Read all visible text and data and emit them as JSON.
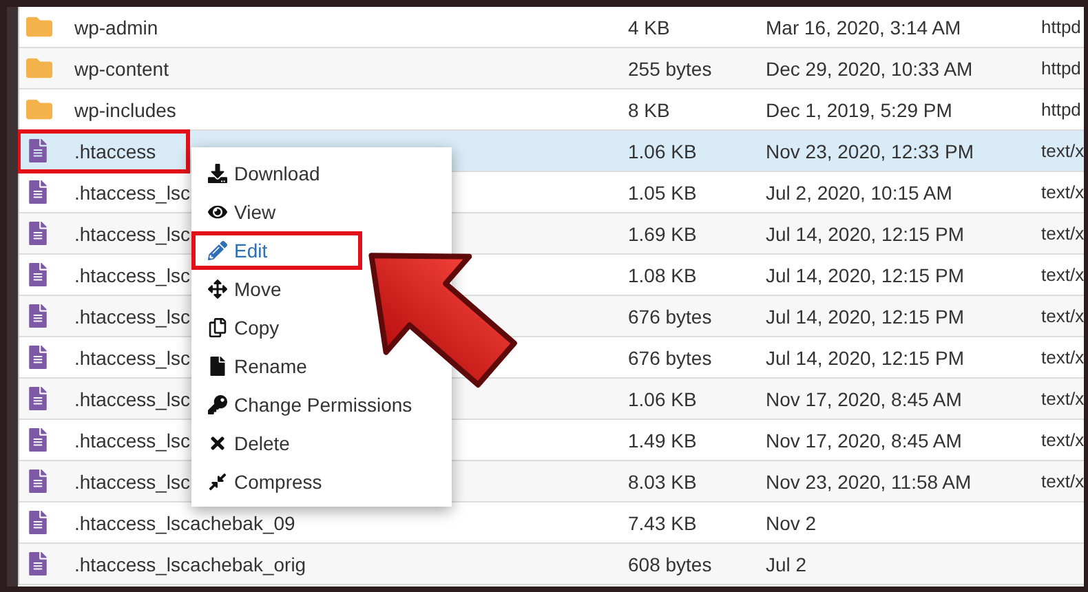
{
  "files": [
    {
      "kind": "folder",
      "name": "wp-admin",
      "size": "4 KB",
      "modified": "Mar 16, 2020, 3:14 AM",
      "type": "httpd",
      "selected": false,
      "outlined": false
    },
    {
      "kind": "folder",
      "name": "wp-content",
      "size": "255 bytes",
      "modified": "Dec 29, 2020, 10:33 AM",
      "type": "httpd",
      "selected": false,
      "outlined": false
    },
    {
      "kind": "folder",
      "name": "wp-includes",
      "size": "8 KB",
      "modified": "Dec 1, 2019, 5:29 PM",
      "type": "httpd",
      "selected": false,
      "outlined": false
    },
    {
      "kind": "file",
      "name": ".htaccess",
      "size": "1.06 KB",
      "modified": "Nov 23, 2020, 12:33 PM",
      "type": "text/x",
      "selected": true,
      "outlined": true
    },
    {
      "kind": "file",
      "name": ".htaccess_lsc",
      "size": "1.05 KB",
      "modified": "Jul 2, 2020, 10:15 AM",
      "type": "text/x",
      "selected": false,
      "outlined": false
    },
    {
      "kind": "file",
      "name": ".htaccess_lsc",
      "size": "1.69 KB",
      "modified": "Jul 14, 2020, 12:15 PM",
      "type": "text/x",
      "selected": false,
      "outlined": false
    },
    {
      "kind": "file",
      "name": ".htaccess_lsc",
      "size": "1.08 KB",
      "modified": "Jul 14, 2020, 12:15 PM",
      "type": "text/x",
      "selected": false,
      "outlined": false
    },
    {
      "kind": "file",
      "name": ".htaccess_lsc",
      "size": "676 bytes",
      "modified": "Jul 14, 2020, 12:15 PM",
      "type": "text/x",
      "selected": false,
      "outlined": false
    },
    {
      "kind": "file",
      "name": ".htaccess_lsc",
      "size": "676 bytes",
      "modified": "Jul 14, 2020, 12:15 PM",
      "type": "text/x",
      "selected": false,
      "outlined": false
    },
    {
      "kind": "file",
      "name": ".htaccess_lsc",
      "size": "1.06 KB",
      "modified": "Nov 17, 2020, 8:45 AM",
      "type": "text/x",
      "selected": false,
      "outlined": false
    },
    {
      "kind": "file",
      "name": ".htaccess_lsc",
      "size": "1.49 KB",
      "modified": "Nov 17, 2020, 8:45 AM",
      "type": "text/x",
      "selected": false,
      "outlined": false
    },
    {
      "kind": "file",
      "name": ".htaccess_lsc",
      "size": "8.03 KB",
      "modified": "Nov 23, 2020, 11:58 AM",
      "type": "text/x",
      "selected": false,
      "outlined": false
    },
    {
      "kind": "file",
      "name": ".htaccess_lscachebak_09",
      "size": "7.43 KB",
      "modified": "Nov 2",
      "selected": false,
      "outlined": false
    },
    {
      "kind": "file",
      "name": ".htaccess_lscachebak_orig",
      "size": "608 bytes",
      "modified": "Jul 2",
      "selected": false,
      "outlined": false
    }
  ],
  "context_menu": {
    "items": [
      {
        "kind": "download",
        "label": "Download",
        "selected": false,
        "outlined": false
      },
      {
        "kind": "view",
        "label": "View",
        "selected": false,
        "outlined": false
      },
      {
        "kind": "edit",
        "label": "Edit",
        "selected": true,
        "outlined": true
      },
      {
        "kind": "move",
        "label": "Move",
        "selected": false,
        "outlined": false
      },
      {
        "kind": "copy",
        "label": "Copy",
        "selected": false,
        "outlined": false
      },
      {
        "kind": "rename",
        "label": "Rename",
        "selected": false,
        "outlined": false
      },
      {
        "kind": "permissions",
        "label": "Change Permissions",
        "selected": false,
        "outlined": false
      },
      {
        "kind": "delete",
        "label": "Delete",
        "selected": false,
        "outlined": false
      },
      {
        "kind": "compress",
        "label": "Compress",
        "selected": false,
        "outlined": false
      }
    ]
  }
}
